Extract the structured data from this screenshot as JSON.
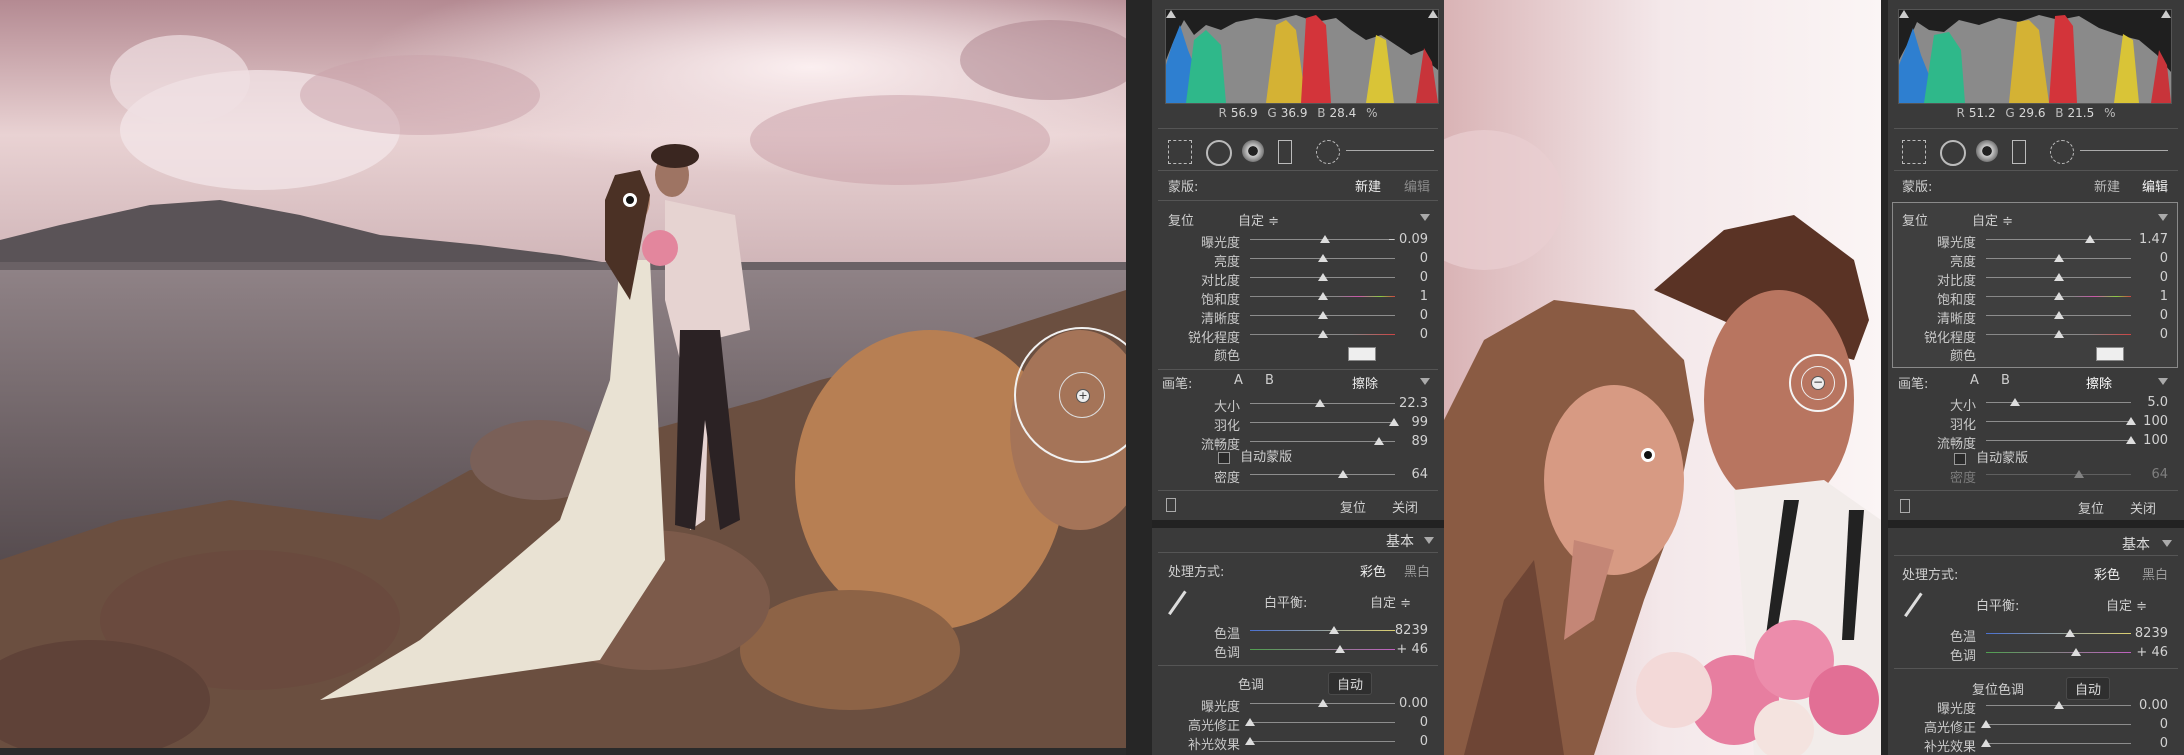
{
  "left_panel": {
    "histogram": {
      "r_label": "R",
      "r": "56.9",
      "g_label": "G",
      "g": "36.9",
      "b_label": "B",
      "b": "28.4",
      "unit": "%"
    },
    "mask": {
      "label": "蒙版:",
      "new": "新建",
      "edit": "编辑"
    },
    "effect": {
      "reset": "复位",
      "preset": "自定 ≑"
    },
    "sliders": [
      {
        "label": "曝光度",
        "value": "– 0.09",
        "pos": 0.52
      },
      {
        "label": "亮度",
        "value": "0",
        "pos": 0.5
      },
      {
        "label": "对比度",
        "value": "0",
        "pos": 0.5
      },
      {
        "label": "饱和度",
        "value": "1",
        "pos": 0.5
      },
      {
        "label": "清晰度",
        "value": "0",
        "pos": 0.5
      },
      {
        "label": "锐化程度",
        "value": "0",
        "pos": 0.5
      }
    ],
    "color_label": "颜色",
    "brush": {
      "label": "画笔:",
      "a": "A",
      "b": "B",
      "erase": "擦除"
    },
    "brush_sliders": [
      {
        "label": "大小",
        "value": "22.3",
        "pos": 0.48
      },
      {
        "label": "羽化",
        "value": "99",
        "pos": 0.99
      },
      {
        "label": "流畅度",
        "value": "89",
        "pos": 0.89
      }
    ],
    "auto_mask": "自动蒙版",
    "density": {
      "label": "密度",
      "value": "64",
      "pos": 0.64
    },
    "footer": {
      "reset": "复位",
      "close": "关闭"
    },
    "basic": {
      "title": "基本",
      "process": "处理方式:",
      "color": "彩色",
      "bw": "黑白"
    },
    "wb": {
      "label": "白平衡:",
      "preset": "自定 ≑"
    },
    "wb_sliders": [
      {
        "label": "色温",
        "value": "8239",
        "pos": 0.58
      },
      {
        "label": "色调",
        "value": "+ 46",
        "pos": 0.62
      }
    ],
    "tone": {
      "label": "色调",
      "auto": "自动"
    },
    "tone_sliders": [
      {
        "label": "曝光度",
        "value": "0.00",
        "pos": 0.5
      },
      {
        "label": "高光修正",
        "value": "0",
        "pos": 0.0
      },
      {
        "label": "补光效果",
        "value": "0",
        "pos": 0.0
      }
    ]
  },
  "right_panel": {
    "histogram": {
      "r_label": "R",
      "r": "51.2",
      "g_label": "G",
      "g": "29.6",
      "b_label": "B",
      "b": "21.5",
      "unit": "%"
    },
    "mask": {
      "label": "蒙版:",
      "new": "新建",
      "edit": "编辑"
    },
    "effect": {
      "reset": "复位",
      "preset": "自定 ≑"
    },
    "sliders": [
      {
        "label": "曝光度",
        "value": "1.47",
        "pos": 0.72
      },
      {
        "label": "亮度",
        "value": "0",
        "pos": 0.5
      },
      {
        "label": "对比度",
        "value": "0",
        "pos": 0.5
      },
      {
        "label": "饱和度",
        "value": "1",
        "pos": 0.5
      },
      {
        "label": "清晰度",
        "value": "0",
        "pos": 0.5
      },
      {
        "label": "锐化程度",
        "value": "0",
        "pos": 0.5
      }
    ],
    "color_label": "颜色",
    "brush": {
      "label": "画笔:",
      "a": "A",
      "b": "B",
      "erase": "擦除"
    },
    "brush_sliders": [
      {
        "label": "大小",
        "value": "5.0",
        "pos": 0.2
      },
      {
        "label": "羽化",
        "value": "100",
        "pos": 1.0
      },
      {
        "label": "流畅度",
        "value": "100",
        "pos": 1.0
      }
    ],
    "auto_mask": "自动蒙版",
    "density": {
      "label": "密度",
      "value": "64",
      "pos": 0.64
    },
    "footer": {
      "reset": "复位",
      "close": "关闭"
    },
    "basic": {
      "title": "基本",
      "process": "处理方式:",
      "color": "彩色",
      "bw": "黑白"
    },
    "wb": {
      "label": "白平衡:",
      "preset": "自定 ≑"
    },
    "wb_sliders": [
      {
        "label": "色温",
        "value": "8239",
        "pos": 0.58
      },
      {
        "label": "色调",
        "value": "+ 46",
        "pos": 0.62
      }
    ],
    "tone": {
      "label": "复位色调",
      "auto": "自动"
    },
    "tone_sliders": [
      {
        "label": "曝光度",
        "value": "0.00",
        "pos": 0.5
      },
      {
        "label": "高光修正",
        "value": "0",
        "pos": 0.0
      },
      {
        "label": "补光效果",
        "value": "0",
        "pos": 0.0
      }
    ]
  }
}
